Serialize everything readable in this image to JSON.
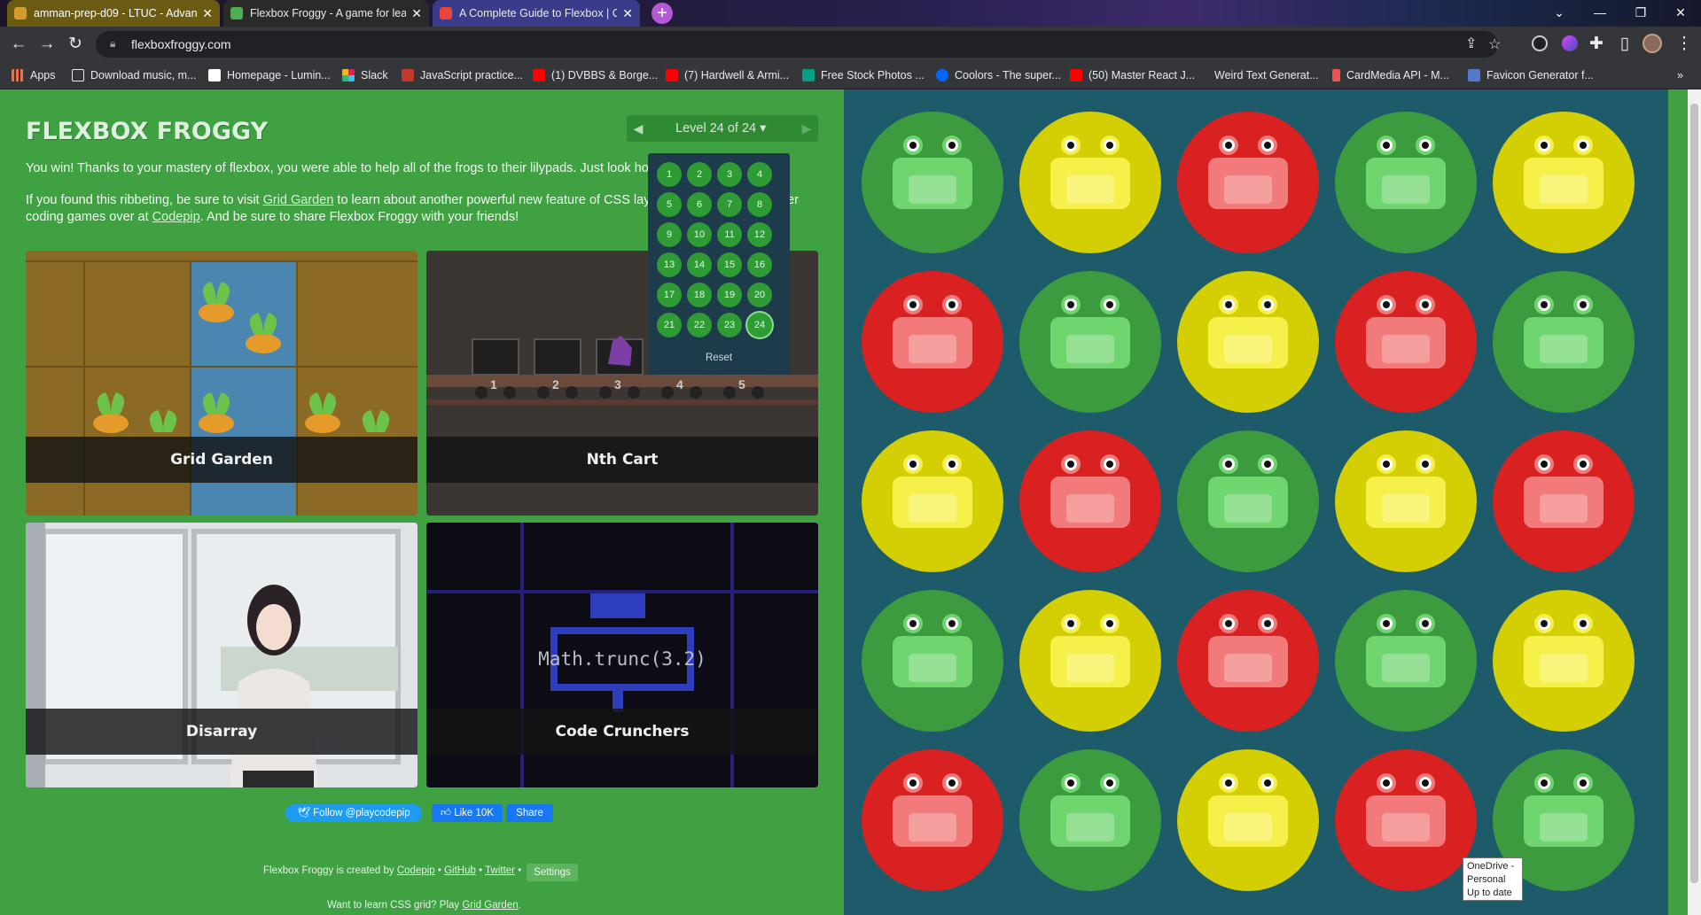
{
  "browser": {
    "tabs": [
      {
        "title": "amman-prep-d09 - LTUC - Advan",
        "favicon_color": "#d49a2a"
      },
      {
        "title": "Flexbox Froggy - A game for learn",
        "favicon_color": "#4caf50"
      },
      {
        "title": "A Complete Guide to Flexbox | C",
        "favicon_color": "#e8453c"
      }
    ],
    "new_tab": "+",
    "window_controls": [
      "⌄",
      "—",
      "❐",
      "✕"
    ],
    "url": "flexboxfroggy.com",
    "bookmarks": [
      {
        "label": "Apps",
        "icon": "apps-grid-icon",
        "color": "#ff6a3d"
      },
      {
        "label": "Download music, m...",
        "icon": "download-icon",
        "color": "#e8eaed"
      },
      {
        "label": "Homepage - Lumin...",
        "icon": "lumin-icon",
        "color": "#ffffff"
      },
      {
        "label": "Slack",
        "icon": "slack-icon",
        "color": "#e01e5a"
      },
      {
        "label": "JavaScript practice...",
        "icon": "js-icon",
        "color": "#c0392b"
      },
      {
        "label": "(1) DVBBS & Borge...",
        "icon": "youtube-icon",
        "color": "#ff0000"
      },
      {
        "label": "(7) Hardwell & Armi...",
        "icon": "youtube-icon",
        "color": "#ff0000"
      },
      {
        "label": "Free Stock Photos ...",
        "icon": "photos-icon",
        "color": "#05a081"
      },
      {
        "label": "Coolors - The super...",
        "icon": "coolors-icon",
        "color": "#0066ff"
      },
      {
        "label": "(50) Master React J...",
        "icon": "youtube-icon",
        "color": "#ff0000"
      },
      {
        "label": "Weird Text Generat...",
        "icon": "text-icon",
        "color": "#e8eaed"
      },
      {
        "label": "CardMedia API - M...",
        "icon": "material-icon",
        "color": "#ef5350"
      },
      {
        "label": "Favicon Generator f...",
        "icon": "favicon-icon",
        "color": "#5577cc"
      }
    ]
  },
  "page": {
    "logo": "FLEXBOX FROGGY",
    "level_label": "Level 24 of 24 ▾",
    "prev_arrow": "◀",
    "next_arrow": "▶",
    "levels": [
      "1",
      "2",
      "3",
      "4",
      "5",
      "6",
      "7",
      "8",
      "9",
      "10",
      "11",
      "12",
      "13",
      "14",
      "15",
      "16",
      "17",
      "18",
      "19",
      "20",
      "21",
      "22",
      "23",
      "24"
    ],
    "current_level": 24,
    "reset_label": "Reset",
    "win_text": "You win! Thanks to your mastery of flexbox, you were able to help all of the frogs to their lilypads. Just look ho",
    "para2_prefix": "If you found this ribbeting, be sure to visit ",
    "para2_link1": "Grid Garden",
    "para2_mid": " to learn about another powerful new feature of CSS lay",
    "para2_tail": "er",
    "para3_prefix": "coding games over at ",
    "para3_link": "Codepip",
    "para3_suffix": ". And be sure to share Flexbox Froggy with your friends!",
    "games": [
      "Grid Garden",
      "Nth Cart",
      "Disarray",
      "Code Crunchers"
    ],
    "cart_numbers": [
      "1",
      "2",
      "3",
      "4",
      "5"
    ],
    "code_text": "Math.trunc(3.2)",
    "follow_label": "Follow @playcodepip",
    "like_label": "Like 10K",
    "share_label": "Share",
    "footer_prefix": "Flexbox Froggy is created by ",
    "footer_link1": "Codepip",
    "footer_sep1": " • ",
    "footer_link2": "GitHub",
    "footer_sep2": " • ",
    "footer_link3": "Twitter",
    "footer_sep3": " • ",
    "settings_label": "Settings",
    "footer2_prefix": "Want to learn CSS grid? Play ",
    "footer2_link": "Grid Garden",
    "footer2_suffix": "."
  },
  "board": {
    "colors": {
      "green": [
        "#3d9b3f",
        "#6fd66f"
      ],
      "yellow": [
        "#d4cf05",
        "#f5f04a"
      ],
      "red": [
        "#d92121",
        "#f27a7a"
      ]
    },
    "rows": [
      [
        "green",
        "yellow",
        "red",
        "green",
        "yellow"
      ],
      [
        "red",
        "green",
        "yellow",
        "red",
        "green"
      ],
      [
        "yellow",
        "red",
        "green",
        "yellow",
        "red"
      ],
      [
        "green",
        "yellow",
        "red",
        "green",
        "yellow"
      ],
      [
        "red",
        "green",
        "yellow",
        "red",
        "green"
      ]
    ]
  },
  "tooltip": [
    "OneDrive -",
    "Personal",
    "Up to date"
  ]
}
